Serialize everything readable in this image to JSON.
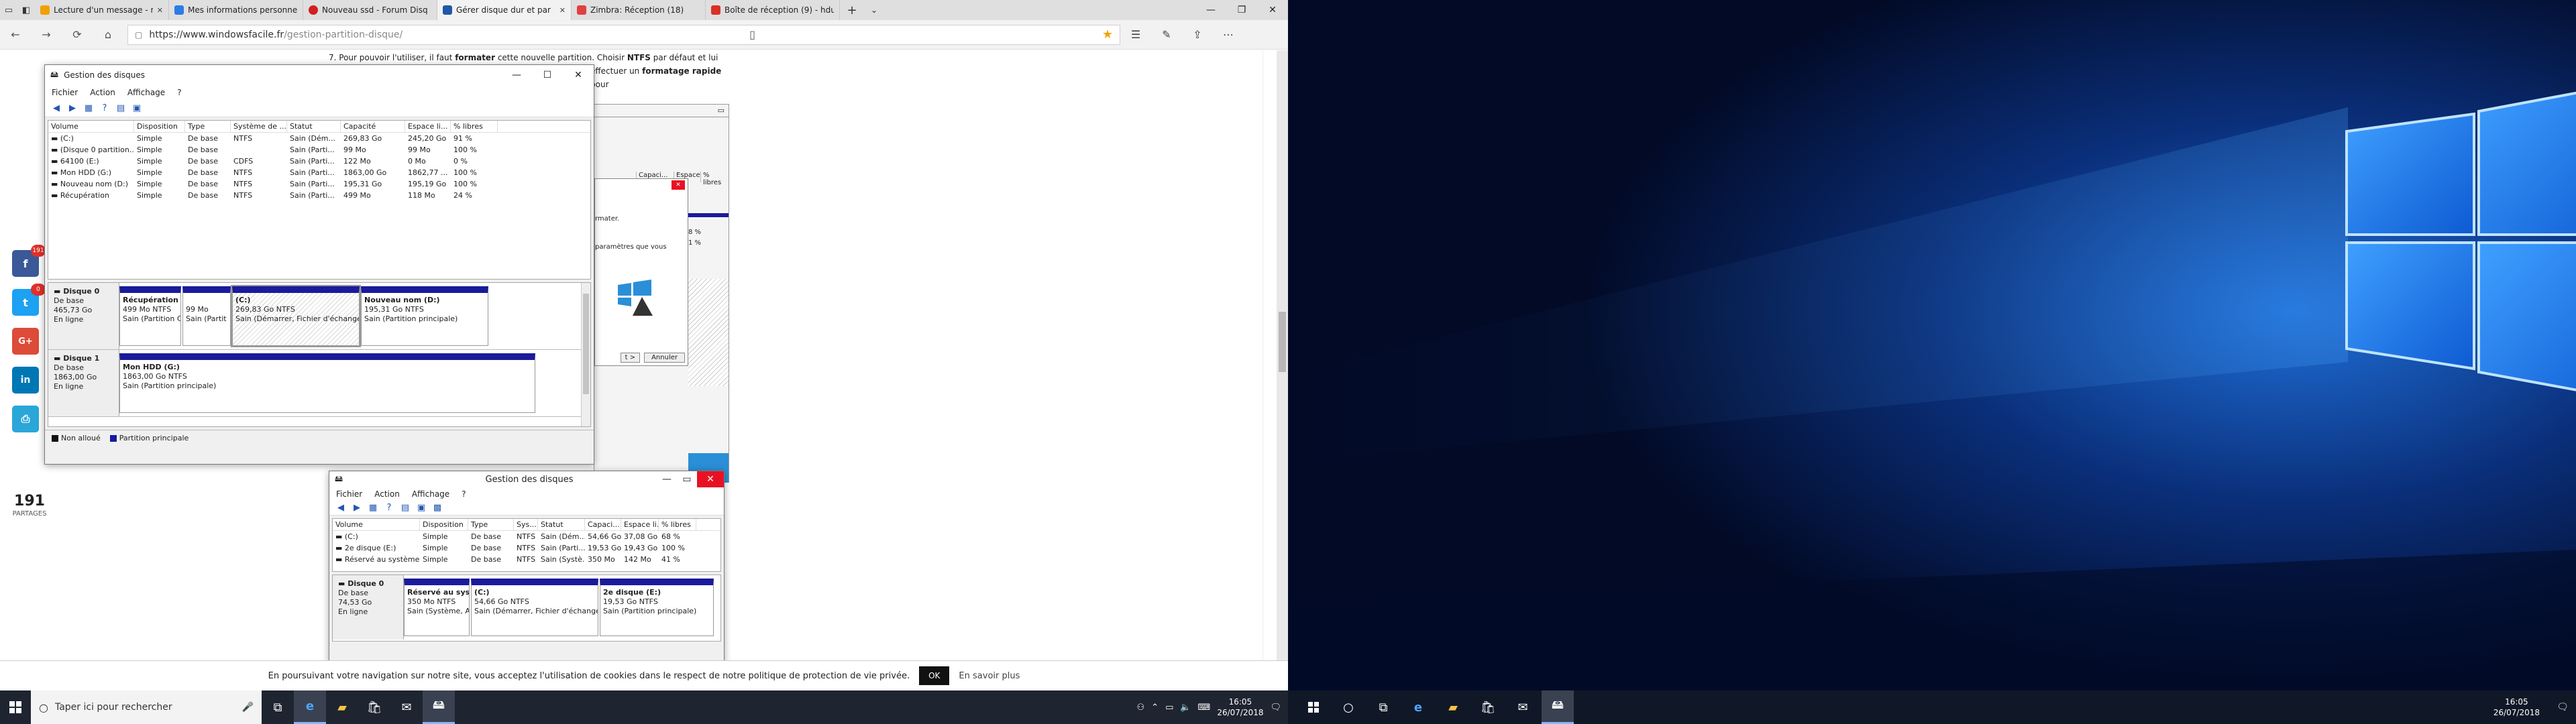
{
  "browser": {
    "tabs": [
      {
        "label": "Lecture d'un message - mai",
        "color": "#f0a000",
        "active": false
      },
      {
        "label": "Mes informations personne",
        "color": "#2d7be5",
        "active": false
      },
      {
        "label": "Nouveau ssd - Forum Disq",
        "color": "#d02020",
        "active": false
      },
      {
        "label": "Gérer disque dur et par",
        "color": "#1f58a8",
        "active": true
      },
      {
        "label": "Zimbra: Réception (18)",
        "color": "#e04040",
        "active": false
      },
      {
        "label": "Boîte de réception (9) - hdu",
        "color": "#d93025",
        "active": false
      }
    ],
    "url_host": "https://www.windowsfacile.fr",
    "url_path": "/gestion-partition-disque/"
  },
  "article": {
    "step_text_1": "7. Pour pouvoir l'utiliser, il faut",
    "step_bold_1": "formater",
    "step_text_2": "cette nouvelle partition. Choisir",
    "step_bold_2": "NTFS",
    "step_text_3": "par défaut et lui indiquer un",
    "line2_text": "effectuer un",
    "line2_bold": "formatage rapide",
    "line2_end": "pour",
    "behind": {
      "col_capacity": "Capaci...",
      "col_free": "Espace li...",
      "col_pct": "% libres",
      "pct_1": "8 %",
      "pct_2": "1 %",
      "fmt": "rmater.",
      "params": "paramètres que vous",
      "back": "t >",
      "cancel": "Annuler"
    }
  },
  "share": {
    "count": "191",
    "label": "PARTAGES",
    "fb_badge": "191",
    "tw_badge": "0",
    "fb": "f",
    "tw": "t",
    "gp": "G+",
    "li": "in",
    "pr": "⎙"
  },
  "dm_main": {
    "title": "Gestion des disques",
    "menu": [
      "Fichier",
      "Action",
      "Affichage",
      "?"
    ],
    "columns": [
      "Volume",
      "Disposition",
      "Type",
      "Système de ...",
      "Statut",
      "Capacité",
      "Espace li...",
      "% libres"
    ],
    "rows": [
      [
        "(C:)",
        "Simple",
        "De base",
        "NTFS",
        "Sain (Dém...",
        "269,83 Go",
        "245,20 Go",
        "91 %"
      ],
      [
        "(Disque 0 partition...",
        "Simple",
        "De base",
        "",
        "Sain (Parti...",
        "99 Mo",
        "99 Mo",
        "100 %"
      ],
      [
        "64100 (E:)",
        "Simple",
        "De base",
        "CDFS",
        "Sain (Parti...",
        "122 Mo",
        "0 Mo",
        "0 %"
      ],
      [
        "Mon HDD (G:)",
        "Simple",
        "De base",
        "NTFS",
        "Sain (Parti...",
        "1863,00 Go",
        "1862,77 ...",
        "100 %"
      ],
      [
        "Nouveau nom (D:)",
        "Simple",
        "De base",
        "NTFS",
        "Sain (Parti...",
        "195,31 Go",
        "195,19 Go",
        "100 %"
      ],
      [
        "Récupération",
        "Simple",
        "De base",
        "NTFS",
        "Sain (Parti...",
        "499 Mo",
        "118 Mo",
        "24 %"
      ]
    ],
    "disk0": {
      "name": "Disque 0",
      "type": "De base",
      "size": "465,73 Go",
      "status": "En ligne",
      "parts": [
        {
          "name": "Récupération",
          "size": "499 Mo NTFS",
          "status": "Sain (Partition C"
        },
        {
          "name": "",
          "size": "99 Mo",
          "status": "Sain (Partit"
        },
        {
          "name": "(C:)",
          "size": "269,83 Go NTFS",
          "status": "Sain (Démarrer, Fichier d'échange,"
        },
        {
          "name": "Nouveau nom (D:)",
          "size": "195,31 Go NTFS",
          "status": "Sain (Partition principale)"
        }
      ]
    },
    "disk1": {
      "name": "Disque 1",
      "type": "De base",
      "size": "1863,00 Go",
      "status": "En ligne",
      "parts": [
        {
          "name": "Mon HDD (G:)",
          "size": "1863,00 Go NTFS",
          "status": "Sain (Partition principale)"
        }
      ]
    },
    "legend": [
      "Non alloué",
      "Partition principale"
    ]
  },
  "dm_article": {
    "title": "Gestion des disques",
    "menu": [
      "Fichier",
      "Action",
      "Affichage",
      "?"
    ],
    "columns": [
      "Volume",
      "Disposition",
      "Type",
      "Sys...",
      "Statut",
      "Capaci...",
      "Espace li...",
      "% libres"
    ],
    "rows": [
      [
        "(C:)",
        "Simple",
        "De base",
        "NTFS",
        "Sain (Dém...",
        "54,66 Go",
        "37,08 Go",
        "68 %"
      ],
      [
        "2e disque (E:)",
        "Simple",
        "De base",
        "NTFS",
        "Sain (Parti...",
        "19,53 Go",
        "19,43 Go",
        "100 %"
      ],
      [
        "Réservé au système",
        "Simple",
        "De base",
        "NTFS",
        "Sain (Systè...",
        "350 Mo",
        "142 Mo",
        "41 %"
      ]
    ],
    "disk0": {
      "name": "Disque 0",
      "type": "De base",
      "size": "74,53 Go",
      "status": "En ligne",
      "parts": [
        {
          "name": "Réservé au syst",
          "size": "350 Mo NTFS",
          "status": "Sain (Système, A"
        },
        {
          "name": "(C:)",
          "size": "54,66 Go NTFS",
          "status": "Sain (Démarrer, Fichier d'échange"
        },
        {
          "name": "2e disque (E:)",
          "size": "19,53 Go NTFS",
          "status": "Sain (Partition principale)"
        }
      ]
    }
  },
  "cookie": {
    "text": "En poursuivant votre navigation sur notre site, vous acceptez l'utilisation de cookies dans le respect de notre politique de protection de vie privée.",
    "ok": "OK",
    "more": "En savoir plus"
  },
  "taskbar": {
    "search_placeholder": "Taper ici pour rechercher",
    "time": "16:05",
    "date": "26/07/2018"
  },
  "taskbar2": {
    "time": "16:05",
    "date": "26/07/2018"
  }
}
